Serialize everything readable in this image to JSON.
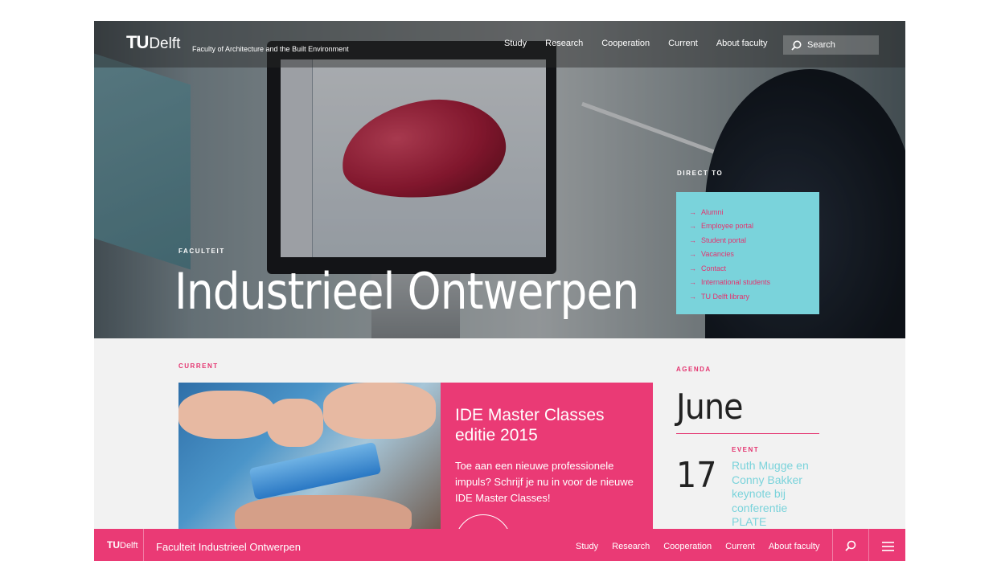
{
  "header": {
    "logo_mark": "TU",
    "logo_word": "Delft",
    "faculty": "Faculty of Architecture and the Built Environment",
    "nav": [
      "Study",
      "Research",
      "Cooperation",
      "Current",
      "About faculty"
    ],
    "search_placeholder": "Search"
  },
  "hero": {
    "kicker": "FACULTEIT",
    "title": "Industrieel Ontwerpen"
  },
  "direct_to": {
    "label": "DIRECT TO",
    "items": [
      "Alumni",
      "Employee portal",
      "Student portal",
      "Vacancies",
      "Contact",
      "International students",
      "TU Delft library"
    ]
  },
  "current": {
    "label": "CURRENT",
    "title": "IDE Master Classes editie 2015",
    "text": "Toe aan een nieuwe professionele impuls? Schrijf je nu in voor de nieuwe IDE Master Classes!"
  },
  "agenda": {
    "label": "AGENDA",
    "month": "June",
    "event_label": "EVENT",
    "event_day": "17",
    "event_title": "Ruth Mugge en Conny Bakker keynote bij conferentie PLATE"
  },
  "footer": {
    "logo_mark": "TU",
    "logo_word": "Delft",
    "name": "Faculteit Industrieel Ontwerpen",
    "nav": [
      "Study",
      "Research",
      "Cooperation",
      "Current",
      "About faculty"
    ]
  },
  "colors": {
    "accent": "#ea3a75",
    "cyan": "#7ad3db"
  }
}
